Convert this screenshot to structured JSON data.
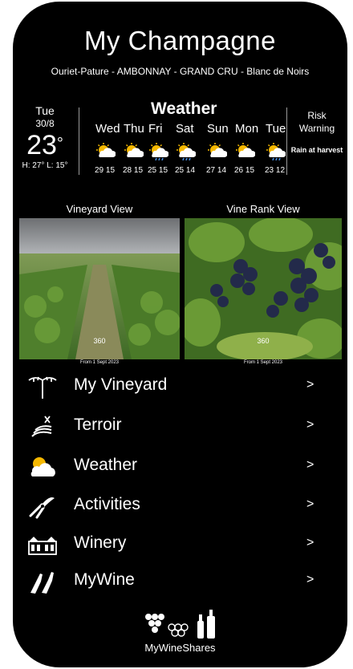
{
  "app": {
    "title": "My Champagne",
    "subtitle": "Ouriet-Pature - AMBONNAY  - GRAND CRU - Blanc de Noirs"
  },
  "today": {
    "day": "Tue",
    "date": "30/8",
    "temp": "23",
    "degree": "°",
    "hl": "H: 27°  L: 15°"
  },
  "weather": {
    "title": "Weather",
    "forecast": [
      {
        "day": "Wed",
        "temps": "29 15",
        "icon": "partly-sunny-icon"
      },
      {
        "day": "Thu",
        "temps": "28 15",
        "icon": "partly-sunny-icon"
      },
      {
        "day": "Fri",
        "temps": "25 15",
        "icon": "rain-cloud-icon"
      },
      {
        "day": "Sat",
        "temps": "25 14",
        "icon": "rain-cloud-icon"
      },
      {
        "day": "Sun",
        "temps": "27 14",
        "icon": "partly-sunny-icon"
      },
      {
        "day": "Mon",
        "temps": "26 15",
        "icon": "partly-sunny-icon"
      },
      {
        "day": "Tue",
        "temps": "23 12",
        "icon": "rain-cloud-icon"
      }
    ]
  },
  "risk": {
    "heading": "Risk Warning",
    "text": "Rain at harvest"
  },
  "views": {
    "vineyard_label": "Vineyard View",
    "vine_rank_label": "Vine Rank View",
    "pano": "360",
    "from_vineyard": "From 1 Sept 2023",
    "from_vine_rank": "From 1 Sept 2023"
  },
  "menu": [
    {
      "label": "My Vineyard",
      "icon": "vine-icon",
      "arrow": ">"
    },
    {
      "label": "Terroir",
      "icon": "terroir-icon",
      "arrow": ">"
    },
    {
      "label": "Weather",
      "icon": "cloud-sun-icon",
      "arrow": ">"
    },
    {
      "label": "Activities",
      "icon": "pruning-shears-icon",
      "arrow": ">"
    },
    {
      "label": "Winery",
      "icon": "winery-building-icon",
      "arrow": ">"
    },
    {
      "label": "MyWine",
      "icon": "wine-bottles-icon",
      "arrow": ">"
    }
  ],
  "brand": {
    "name": "MyWineShares",
    "icon": "grapes-and-bottles-icon"
  },
  "colors": {
    "background": "#000000",
    "text": "#ffffff",
    "sun": "#f5b800",
    "cloud": "#ffffff",
    "rain": "#4a90e2"
  }
}
